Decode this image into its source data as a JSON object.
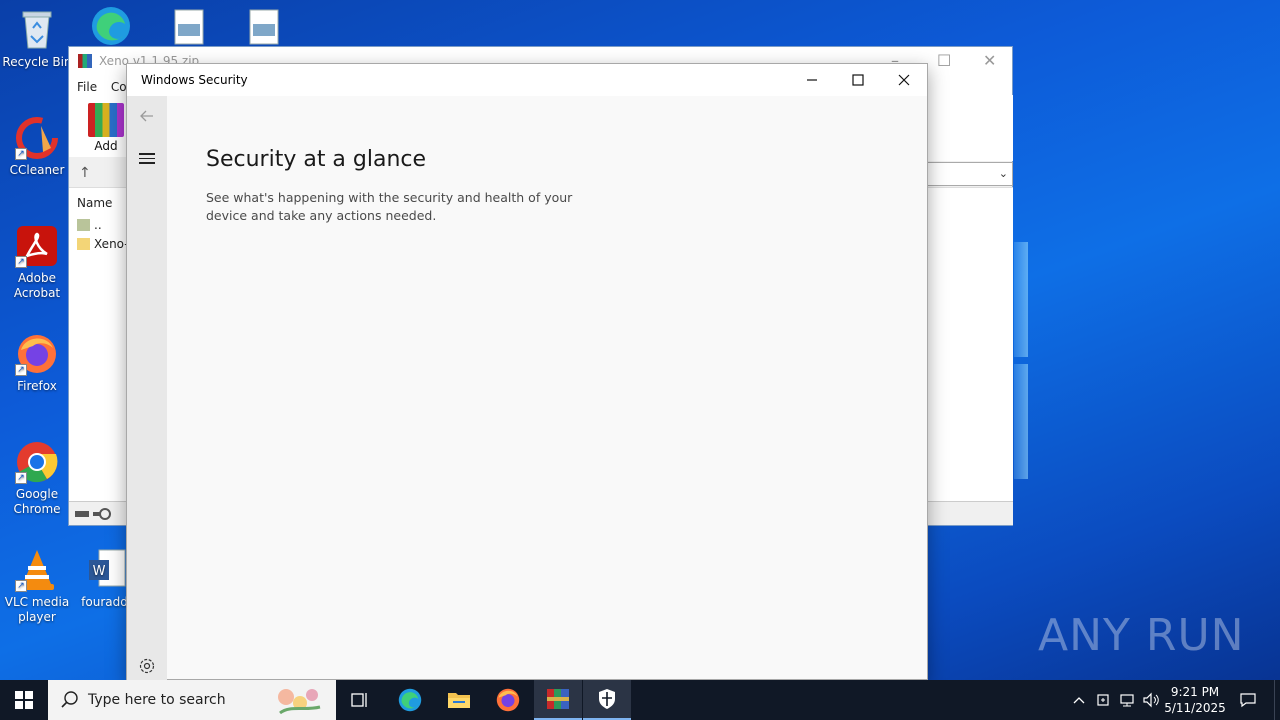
{
  "desktop": {
    "icons": [
      {
        "label": "Recycle Bin"
      },
      {
        "label": "CCleaner"
      },
      {
        "label": "Adobe Acrobat"
      },
      {
        "label": "Firefox"
      },
      {
        "label": "Google Chrome"
      },
      {
        "label": "VLC media player"
      },
      {
        "label": "fouraddr"
      }
    ]
  },
  "winrar": {
    "title": "Xeno v1.1.95.zip",
    "menu": [
      "File",
      "Cor"
    ],
    "add_label": "Add",
    "column_name": "Name",
    "rows": [
      "..",
      "Xeno-"
    ]
  },
  "security": {
    "title": "Windows Security",
    "heading": "Security at a glance",
    "subtitle": "See what's happening with the security and health of your device and take any actions needed."
  },
  "watermark": "ANY RUN",
  "taskbar": {
    "search_placeholder": "Type here to search",
    "apps": [
      "task-view",
      "edge",
      "file-explorer",
      "firefox",
      "winrar",
      "windows-security"
    ],
    "time": "9:21 PM",
    "date": "5/11/2025"
  },
  "colors": {
    "desktop_blue": "#0d5bd8",
    "taskbar": "#101826",
    "security_bg": "#f9f9f9",
    "security_nav": "#e8e8e8"
  }
}
